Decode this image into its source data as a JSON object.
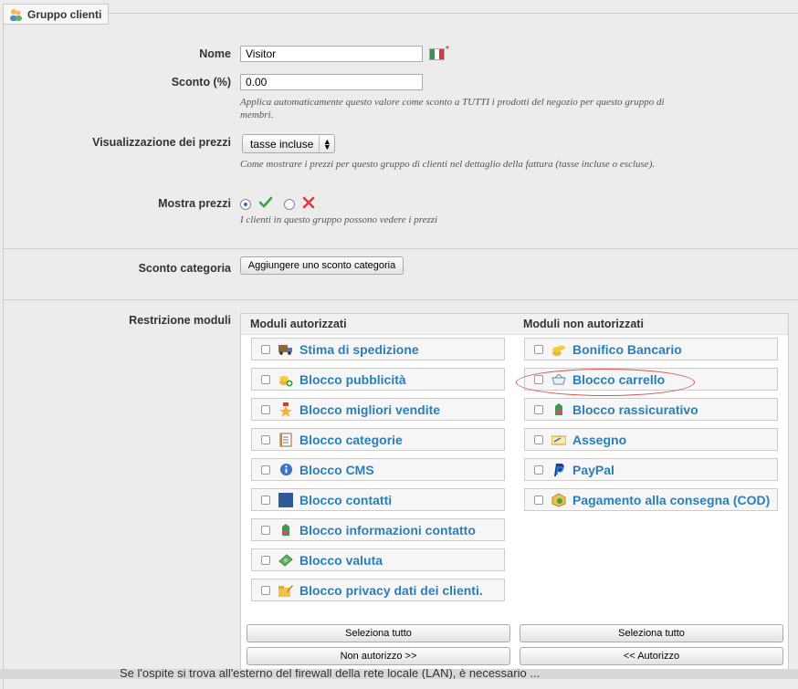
{
  "fieldset": {
    "legend": "Gruppo clienti",
    "legend_icon": "group-icon"
  },
  "fields": {
    "name": {
      "label": "Nome",
      "value": "Visitor",
      "required_mark": "*",
      "flag": "italian-flag-icon"
    },
    "discount": {
      "label": "Sconto (%)",
      "value": "0.00",
      "hint": "Applica automaticamente questo valore come sconto a TUTTI i prodotti del negozio per questo gruppo di membri."
    },
    "price_display": {
      "label": "Visualizzazione dei prezzi",
      "selected": "tasse incluse",
      "hint": "Come mostrare i prezzi per questo gruppo di clienti nel dettaglio della fattura (tasse incluse o escluse)."
    },
    "show_prices": {
      "label": "Mostra prezzi",
      "yes_selected": true,
      "yes_icon": "green-check-icon",
      "no_icon": "red-cross-icon",
      "hint": "I clienti in questo gruppo possono vedere i prezzi"
    },
    "category_discount": {
      "label": "Sconto categoria",
      "button": "Aggiungere uno sconto categoria"
    },
    "module_restriction": {
      "label": "Restrizione moduli"
    }
  },
  "modules": {
    "authorized_title": "Moduli autorizzati",
    "unauthorized_title": "Moduli non autorizzati",
    "authorized": [
      {
        "name": "Stima di spedizione",
        "icon": "truck-icon"
      },
      {
        "name": "Blocco pubblicità",
        "icon": "coins-add-icon"
      },
      {
        "name": "Blocco migliori vendite",
        "icon": "star-badge-icon"
      },
      {
        "name": "Blocco categorie",
        "icon": "document-list-icon"
      },
      {
        "name": "Blocco CMS",
        "icon": "info-icon"
      },
      {
        "name": "Blocco contatti",
        "icon": "blue-square-icon"
      },
      {
        "name": "Blocco informazioni contatto",
        "icon": "green-tag-icon"
      },
      {
        "name": "Blocco valuta",
        "icon": "money-icon"
      },
      {
        "name": "Blocco privacy dati dei clienti.",
        "icon": "folder-edit-icon"
      }
    ],
    "unauthorized": [
      {
        "name": "Bonifico Bancario",
        "icon": "coins-icon"
      },
      {
        "name": "Blocco carrello",
        "icon": "basket-icon",
        "highlighted": true
      },
      {
        "name": "Blocco rassicurativo",
        "icon": "green-tag-icon"
      },
      {
        "name": "Assegno",
        "icon": "cheque-icon"
      },
      {
        "name": "PayPal",
        "icon": "paypal-icon"
      },
      {
        "name": "Pagamento alla consegna (COD)",
        "icon": "cod-icon"
      }
    ],
    "select_all_left": "Seleziona tutto",
    "select_all_right": "Seleziona tutto",
    "deny_button": "Non autorizzo >>",
    "allow_button": "<< Autorizzo"
  },
  "bottom_text": "Se l'ospite si trova all'esterno del firewall della rete locale (LAN), è necessario ...",
  "colors": {
    "link": "#2a7fb8",
    "highlight_ring": "#d9534f"
  }
}
